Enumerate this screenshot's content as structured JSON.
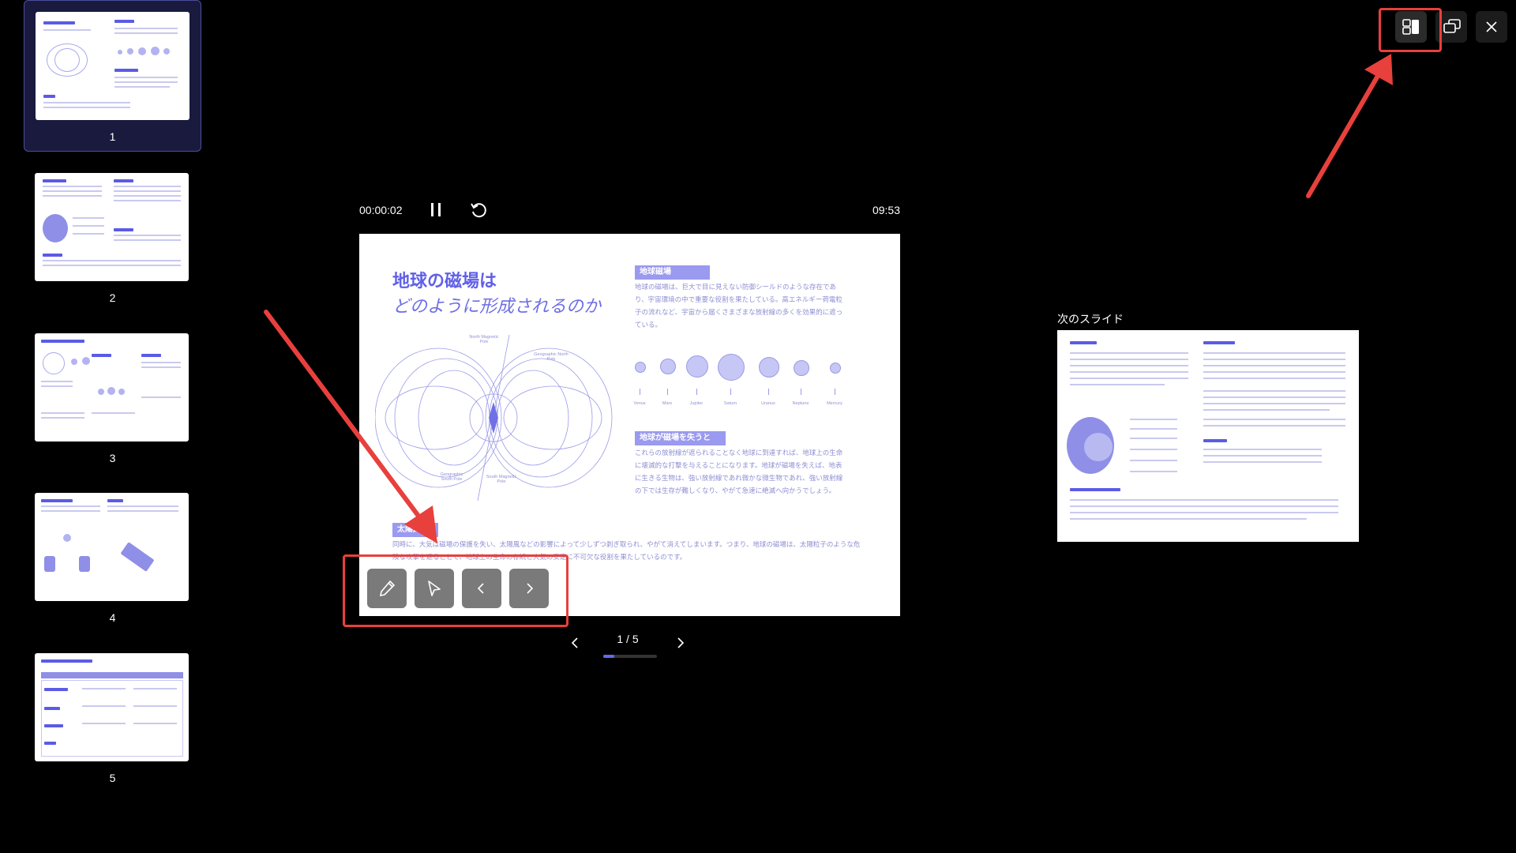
{
  "app": {
    "timer": "00:00:02",
    "remaining": "09:53",
    "page_label": "1 / 5",
    "progress": 0.2,
    "next_slide_label": "次のスライド"
  },
  "thumbnails": [
    {
      "number": "1",
      "active": true
    },
    {
      "number": "2",
      "active": false
    },
    {
      "number": "3",
      "active": false
    },
    {
      "number": "4",
      "active": false
    },
    {
      "number": "5",
      "active": false
    }
  ],
  "slide": {
    "title": "地球の磁場は",
    "subtitle": "どのように形成されるのか",
    "tag1": "地球磁場",
    "para1": "地球の磁場は、巨大で目に見えない防御シールドのような存在であり、宇宙環境の中で重要な役割を果たしている。高エネルギー荷電粒子の流れなど、宇宙から届くさまざまな放射線の多くを効果的に遮っている。",
    "tag2": "地球が磁場を失うと",
    "para2": "これらの放射線が遮られることなく地球に到達すれば、地球上の生命に壊滅的な打撃を与えることになります。地球が磁場を失えば、地表に生きる生物は、強い放射線であれ微かな微生物であれ、強い放射線の下では生存が難しくなり、やがて急速に絶滅へ向かうでしょう。",
    "tag3": "太陽風",
    "para3": "同時に、大気は磁場の保護を失い、太陽風などの影響によって少しずつ剥ぎ取られ、やがて消えてしまいます。つまり、地球の磁場は、太陽粒子のような危険な攻撃を遮ることで、地球上の生命の存続と大気の安定に不可欠な役割を果たしているのです。",
    "diagram_labels": {
      "north_magnetic": "North Magnetic Pole",
      "north_geo": "Geographic North Pole",
      "south_geo": "Geographic South Pole",
      "south_magnetic": "South Magnetic Pole"
    },
    "planets": [
      "Venus",
      "Mars",
      "Jupiter",
      "Saturn",
      "Uranus",
      "Neptune",
      "Mercury"
    ]
  },
  "icons": {
    "pen": "pen-icon",
    "pointer": "pointer-icon",
    "prev": "chevron-left-icon",
    "next": "chevron-right-icon",
    "pause": "pause-icon",
    "reset": "reset-icon",
    "layout": "layout-icon",
    "monitor": "display-switch-icon",
    "close": "close-icon"
  },
  "colors": {
    "accent": "#5b5be6",
    "slide_text": "#8e8ed4",
    "highlight": "#e8403c",
    "progress": "#5d6cf0"
  }
}
